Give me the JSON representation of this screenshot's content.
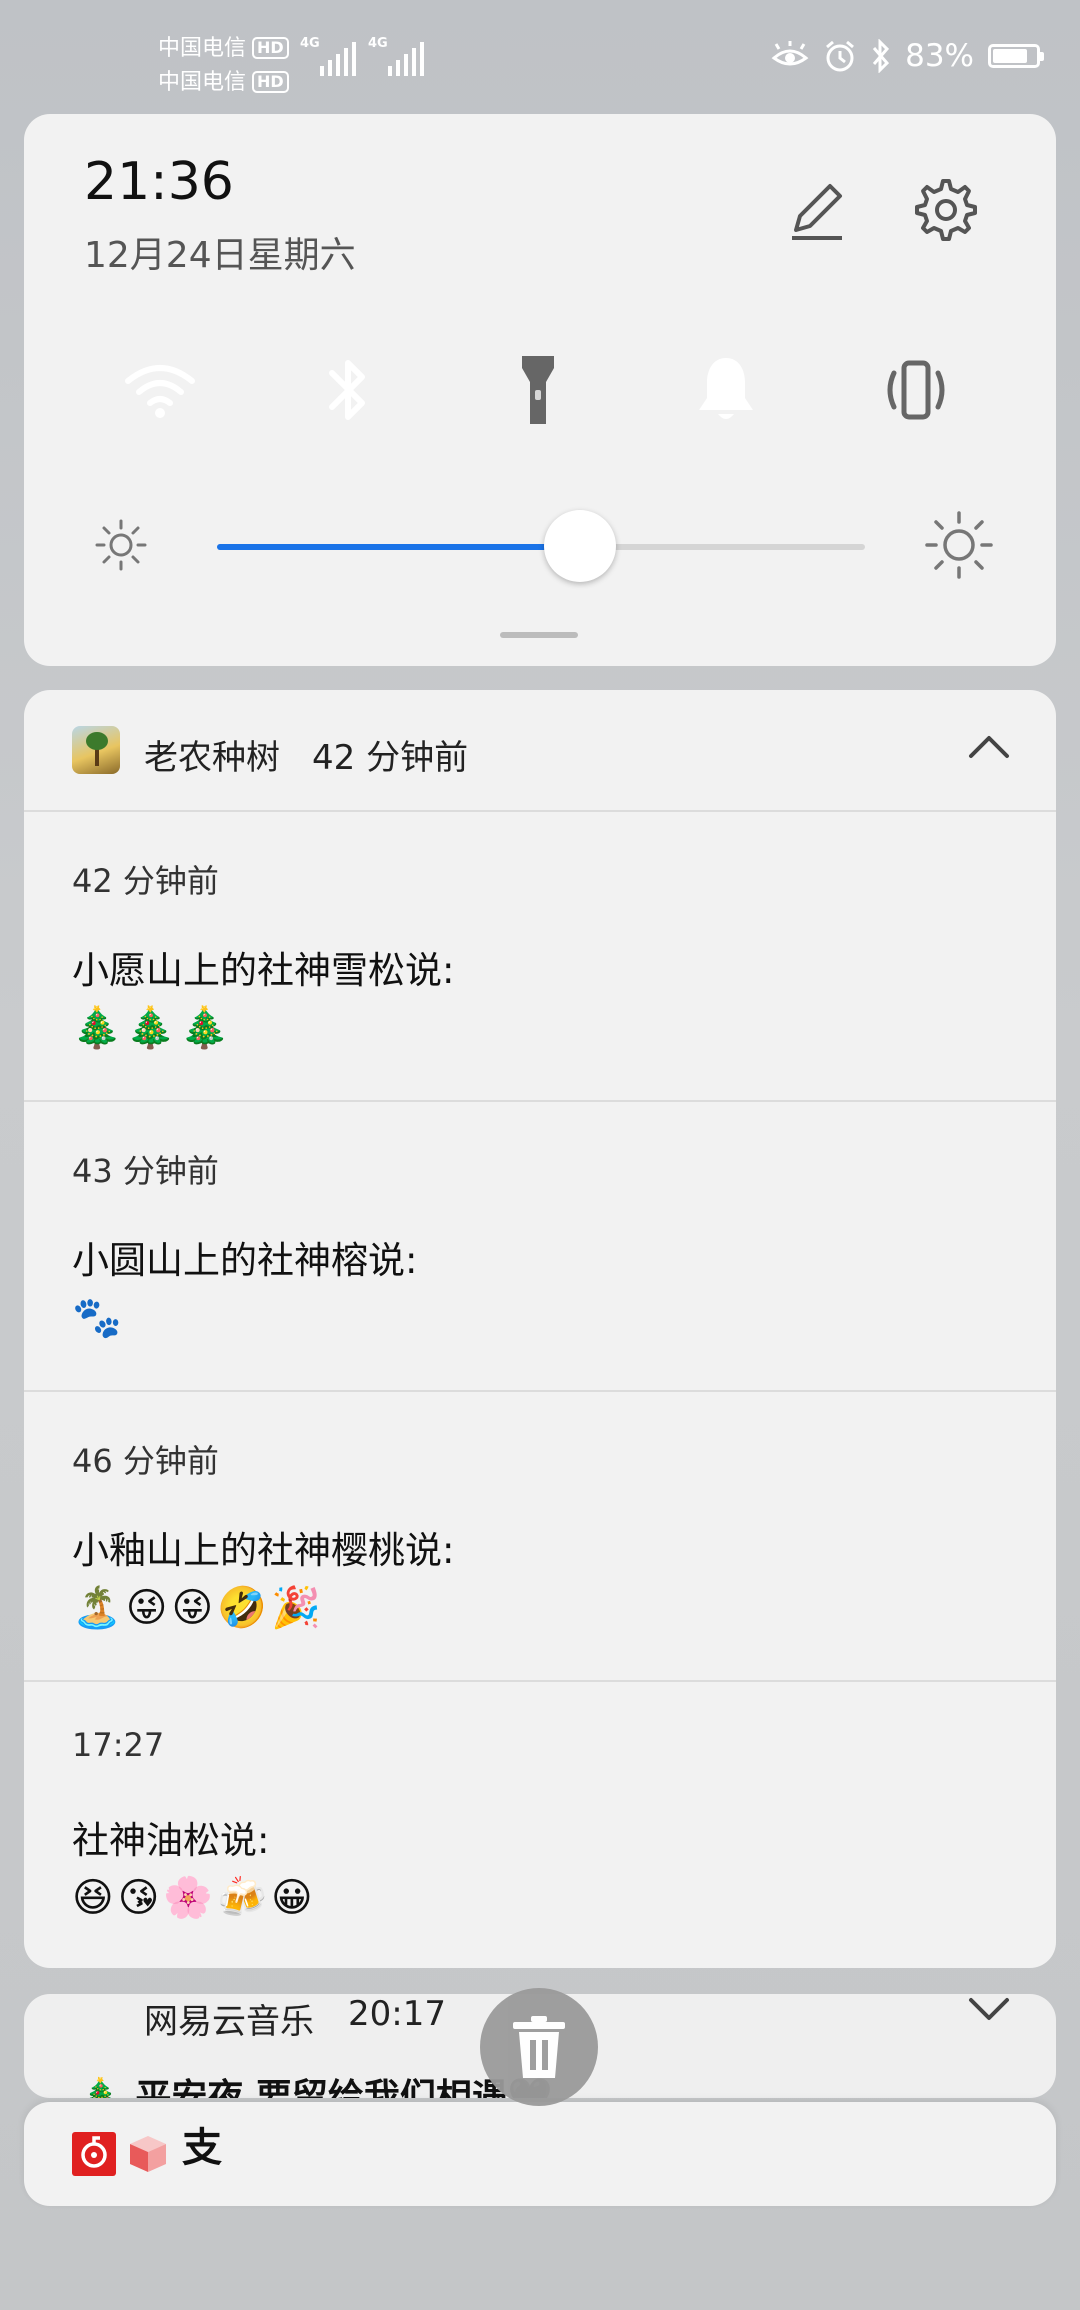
{
  "status_bar": {
    "carriers": [
      "中国电信",
      "中国电信"
    ],
    "hd_badge": "HD",
    "network_types": [
      "4G",
      "4G"
    ],
    "battery_percent": "83%",
    "battery_level": 0.83,
    "icons": [
      "eye-comfort-icon",
      "alarm-icon",
      "bluetooth-icon",
      "battery-charging-icon"
    ]
  },
  "quick_settings": {
    "time": "21:36",
    "date": "12月24日星期六",
    "toggles": [
      {
        "name": "wifi",
        "icon": "wifi-icon",
        "on": true
      },
      {
        "name": "bluetooth",
        "icon": "bluetooth-icon",
        "on": true
      },
      {
        "name": "flashlight",
        "icon": "flashlight-icon",
        "on": false
      },
      {
        "name": "sound",
        "icon": "bell-icon",
        "on": true
      },
      {
        "name": "vibrate",
        "icon": "vibrate-icon",
        "on": false
      }
    ],
    "brightness_level": 0.56,
    "accent_color": "#0a7af6"
  },
  "notification_group": {
    "app_name": "老农种树",
    "time_ago": "42 分钟前",
    "items": [
      {
        "time": "42 分钟前",
        "title": "小愿山上的社神雪松说:",
        "body": "🎄🎄🎄"
      },
      {
        "time": "43 分钟前",
        "title": "小圆山上的社神榕说:",
        "body": "🐾"
      },
      {
        "time": "46 分钟前",
        "title": "小釉山上的社神樱桃说:",
        "body": "🏝️😜😜🤣🎉"
      },
      {
        "time": "17:27",
        "title": "社神油松说:",
        "body": "😆😘🌸🍻😀"
      }
    ]
  },
  "music_notification": {
    "app_name": "网易云音乐",
    "time": "20:17",
    "song": "🎄 平安夜 要留给我们相遇🖤"
  },
  "bottom_bar": {
    "app_icons": [
      "netease-music-icon",
      "red-box-icon",
      "alipay-icon"
    ],
    "alipay_glyph": "支"
  }
}
